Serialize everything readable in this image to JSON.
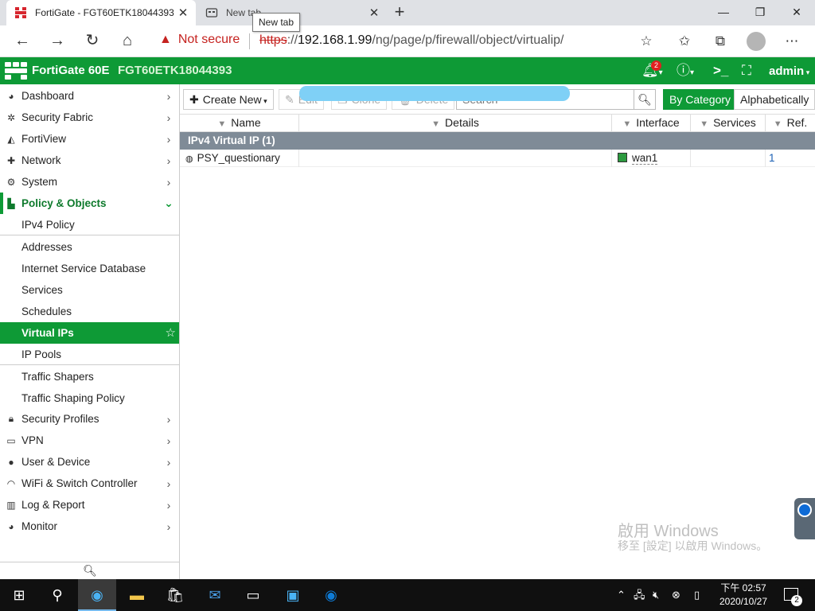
{
  "browser": {
    "tabs": [
      {
        "title": "FortiGate - FGT60ETK18044393",
        "active": true
      },
      {
        "title": "New tab",
        "active": false
      }
    ],
    "tooltip": "New tab",
    "security_label": "Not secure",
    "url": {
      "scheme": "https",
      "sep": "://",
      "host": "192.168.1.99",
      "path": "/ng/page/p/firewall/object/virtualip/"
    }
  },
  "fortigate": {
    "model": "FortiGate 60E",
    "serial": "FGT60ETK18044393",
    "notification_count": "2",
    "user": "admin",
    "accent_color": "#0e9a36"
  },
  "sidebar": {
    "top_items": [
      {
        "label": "Dashboard",
        "icon": "dashboard-icon"
      },
      {
        "label": "Security Fabric",
        "icon": "fabric-icon"
      },
      {
        "label": "FortiView",
        "icon": "fortiview-icon"
      },
      {
        "label": "Network",
        "icon": "network-icon"
      },
      {
        "label": "System",
        "icon": "gear-icon"
      }
    ],
    "open_group": {
      "label": "Policy & Objects",
      "icon": "policy-icon"
    },
    "sub_items": [
      {
        "label": "IPv4 Policy"
      },
      {
        "label": "Addresses"
      },
      {
        "label": "Internet Service Database"
      },
      {
        "label": "Services"
      },
      {
        "label": "Schedules"
      },
      {
        "label": "Virtual IPs",
        "active": true
      },
      {
        "label": "IP Pools"
      },
      {
        "label": "Traffic Shapers"
      },
      {
        "label": "Traffic Shaping Policy"
      }
    ],
    "bottom_items": [
      {
        "label": "Security Profiles",
        "icon": "lock-icon"
      },
      {
        "label": "VPN",
        "icon": "laptop-icon"
      },
      {
        "label": "User & Device",
        "icon": "user-icon"
      },
      {
        "label": "WiFi & Switch Controller",
        "icon": "wifi-icon"
      },
      {
        "label": "Log & Report",
        "icon": "chart-icon"
      },
      {
        "label": "Monitor",
        "icon": "pie-icon"
      }
    ]
  },
  "toolbar": {
    "create_new": "Create New",
    "edit": "Edit",
    "clone": "Clone",
    "delete": "Delete",
    "search_placeholder": "Search",
    "view_by_category": "By Category",
    "view_alphabetically": "Alphabetically"
  },
  "table": {
    "columns": [
      "Name",
      "Details",
      "Interface",
      "Services",
      "Ref."
    ],
    "group_label": "IPv4 Virtual IP (1)",
    "rows": [
      {
        "name": "PSY_questionary",
        "details": "",
        "interface": "wan1",
        "services": "",
        "ref": "1"
      }
    ]
  },
  "watermark": {
    "line1": "啟用 Windows",
    "line2": "移至 [設定] 以啟用 Windows。"
  },
  "taskbar": {
    "time": "下午 02:57",
    "date": "2020/10/27",
    "notifications": "2"
  }
}
